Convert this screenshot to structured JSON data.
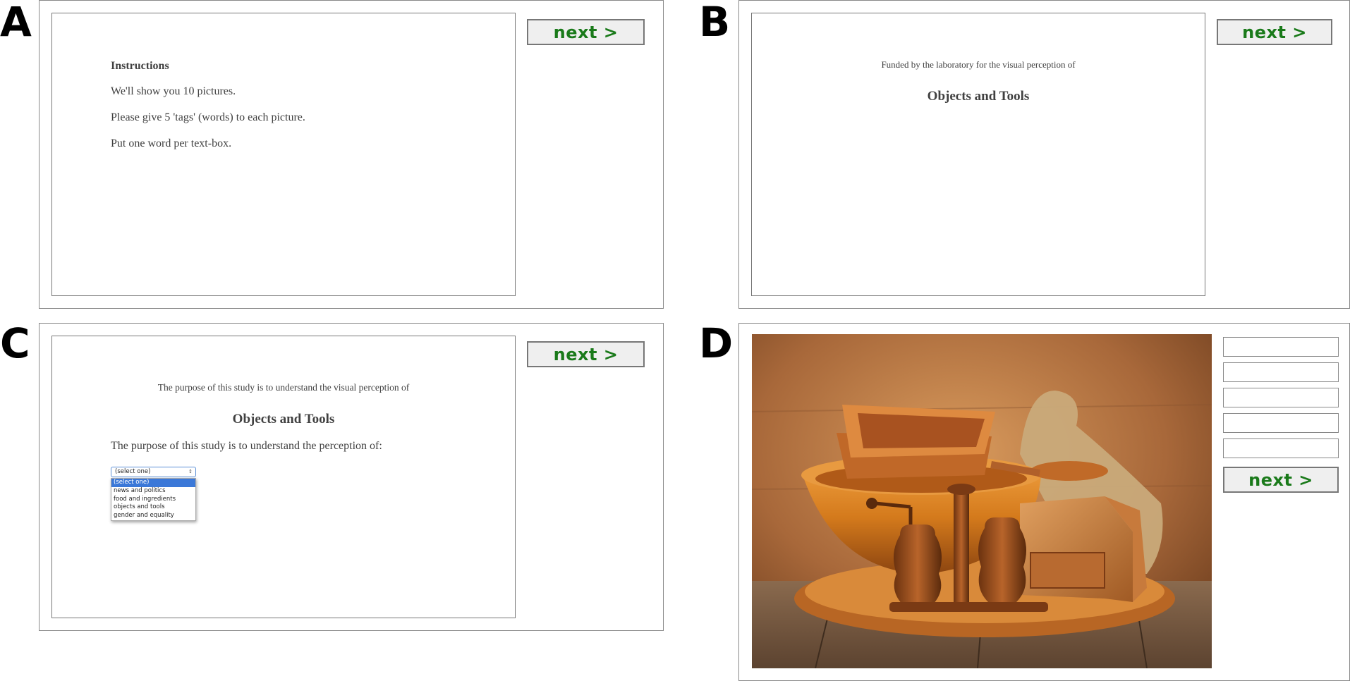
{
  "panels": {
    "a": {
      "letter": "A",
      "next_label": "next >",
      "heading": "Instructions",
      "lines": [
        "We'll show you 10 pictures.",
        "Please give 5 'tags' (words) to each picture.",
        "Put one word per text-box."
      ]
    },
    "b": {
      "letter": "B",
      "next_label": "next >",
      "funded_line": "Funded by the laboratory for the visual perception of",
      "title": "Objects and Tools"
    },
    "c": {
      "letter": "C",
      "next_label": "next >",
      "purpose_line": "The purpose of this study is to understand the visual perception of",
      "title": "Objects and Tools",
      "question": "The purpose of this study is to understand the perception of:",
      "select_value": "(select one)",
      "options": [
        "(select one)",
        "news and politics",
        "food and ingredients",
        "objects and tools",
        "gender and equality"
      ]
    },
    "d": {
      "letter": "D",
      "next_label": "next >",
      "tag_inputs": [
        "",
        "",
        "",
        "",
        ""
      ]
    }
  },
  "colors": {
    "next_text": "#1a7a1a",
    "option_highlight": "#3b78d8"
  }
}
